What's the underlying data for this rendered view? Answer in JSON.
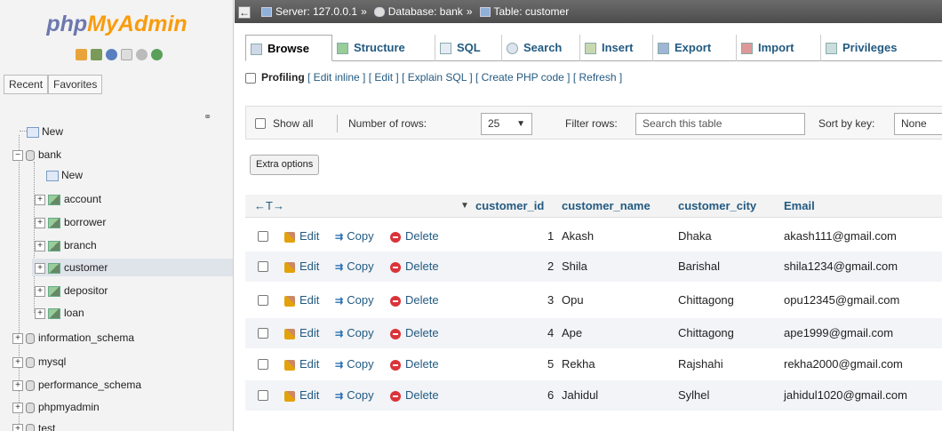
{
  "logo": {
    "part1": "php",
    "part2": "MyAdmin"
  },
  "nav_tabs": {
    "recent": "Recent",
    "favorites": "Favorites"
  },
  "tree": {
    "new": "New",
    "bank": "bank",
    "bank_new": "New",
    "tables": [
      "account",
      "borrower",
      "branch",
      "customer",
      "depositor",
      "loan"
    ],
    "selected_table": "customer",
    "databases": [
      "information_schema",
      "mysql",
      "performance_schema",
      "phpmyadmin",
      "test"
    ]
  },
  "breadcrumb": {
    "server": "Server: 127.0.0.1",
    "sep": "»",
    "database": "Database: bank",
    "table": "Table: customer"
  },
  "tabs": [
    "Browse",
    "Structure",
    "SQL",
    "Search",
    "Insert",
    "Export",
    "Import",
    "Privileges"
  ],
  "profiling": {
    "label": "Profiling",
    "links": "[ Edit inline ] [ Edit ] [ Explain SQL ] [ Create PHP code ] [ Refresh ]"
  },
  "filters": {
    "show_all": "Show all",
    "num_rows_label": "Number of rows:",
    "num_rows_value": "25",
    "filter_label": "Filter rows:",
    "search_placeholder": "Search this table",
    "sort_label": "Sort by key:",
    "sort_value": "None"
  },
  "extra_options": "Extra options",
  "table": {
    "arrows": "←T→",
    "sort_icon": "▼",
    "columns": [
      "customer_id",
      "customer_name",
      "customer_city",
      "Email"
    ],
    "actions": {
      "edit": "Edit",
      "copy": "Copy",
      "delete": "Delete"
    },
    "rows": [
      [
        "1",
        "Akash",
        "Dhaka",
        "akash111@gmail.com"
      ],
      [
        "2",
        "Shila",
        "Barishal",
        "shila1234@gmail.com"
      ],
      [
        "3",
        "Opu",
        "Chittagong",
        "opu12345@gmail.com"
      ],
      [
        "4",
        "Ape",
        "Chittagong",
        "ape1999@gmail.com"
      ],
      [
        "5",
        "Rekha",
        "Rajshahi",
        "rekha2000@gmail.com"
      ],
      [
        "6",
        "Jahidul",
        "Sylhel",
        "jahidul1020@gmail.com"
      ]
    ]
  },
  "colors": {
    "link": "#235a81",
    "logo_blue": "#6c78af",
    "logo_orange": "#f89c0e",
    "header_bar": "#555555"
  }
}
